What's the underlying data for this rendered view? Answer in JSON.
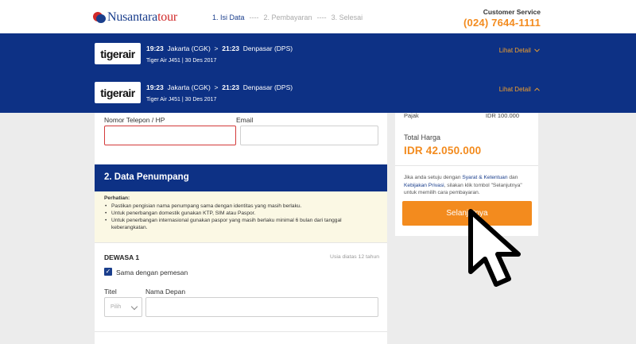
{
  "header": {
    "brand_main": "Nusantara",
    "brand_accent": "tour",
    "steps": [
      {
        "label": "1. Isi Data",
        "active": true
      },
      {
        "label": "----",
        "active": false
      },
      {
        "label": "2. Pembayaran",
        "active": false
      },
      {
        "label": "----",
        "active": false
      },
      {
        "label": "3. Selesai",
        "active": false
      }
    ],
    "customer_service_label": "Customer Service",
    "customer_service_phone": "(024) 7644-1111"
  },
  "flights": [
    {
      "airline_logo_text": "tigerair",
      "depart_time": "19:23",
      "depart_city": "Jakarta (CGK)",
      "arrow": ">",
      "arrive_time": "21:23",
      "arrive_city": "Denpasar (DPS)",
      "meta": "Tiger Air J451  |  30 Des 2017",
      "detail_label": "Lihat Detail",
      "detail_icon": "chevron-down-icon"
    },
    {
      "airline_logo_text": "tigerair",
      "depart_time": "19:23",
      "depart_city": "Jakarta (CGK)",
      "arrow": ">",
      "arrive_time": "21:23",
      "arrive_city": "Denpasar (DPS)",
      "meta": "Tiger Air J451  |  30 Des 2017",
      "detail_label": "Lihat Detail",
      "detail_icon": "chevron-up-icon"
    }
  ],
  "contact_form": {
    "phone_label": "Nomor Telepon / HP",
    "phone_value": "",
    "email_label": "Email",
    "email_value": ""
  },
  "passenger_section": {
    "title": "2. Data Penumpang",
    "notice_title": "Perhatian:",
    "notice_items": [
      "Pastikan pengisian nama penumpang sama dengan identitas yang masih berlaku.",
      "Untuk penerbangan domestik gunakan KTP, SIM atau Paspor.",
      "Untuk penerbangan internasional gunakan paspor yang masih berlaku minimal 6 bulan dari tanggal keberangkatan."
    ],
    "adult_title": "DEWASA 1",
    "adult_note": "Usia diatas 12 tahun",
    "same_as_booker_label": "Sama dengan pemesan",
    "same_as_booker_checked": true,
    "title_label": "Titel",
    "title_select_value": "Pilih",
    "first_name_label": "Nama Depan",
    "first_name_value": ""
  },
  "summary": {
    "tax_label": "Pajak",
    "tax_value": "IDR 100.000",
    "total_label": "Total Harga",
    "total_value": "IDR 42.050.000",
    "terms_pre": "Jika anda setuju dengan ",
    "terms_link1": "Syarat & Ketentuan",
    "terms_mid": " dan ",
    "terms_link2": "Kebijakan Privasi",
    "terms_post": ", silakan klik tombol \"Selanjutnya\" untuk memilih cara pembayaran.",
    "cta_label": "Selanjutnya"
  },
  "colors": {
    "navy": "#0d3185",
    "orange": "#f38b1e",
    "error_border": "#d43a3a"
  }
}
